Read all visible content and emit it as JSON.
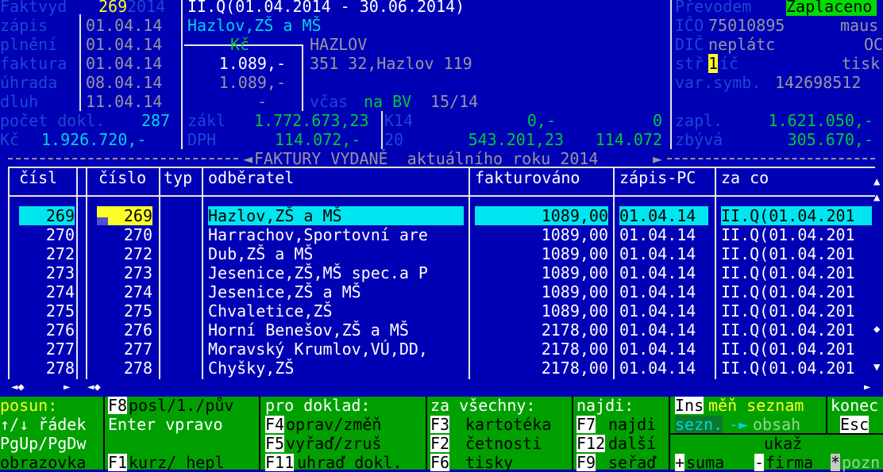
{
  "header_left": {
    "labels": [
      "Faktvyd",
      "zápis",
      "plnění",
      "faktura",
      "úhrada",
      "dluh"
    ],
    "invoice_no": "269",
    "year": "2014",
    "dates": [
      "01.04.14",
      "01.04.14",
      "01.04.14",
      "08.04.14",
      "11.04.14"
    ]
  },
  "header_mid": {
    "period": "II.Q(01.04.2014 - 30.06.2014)",
    "customer": "Hazlov,ZŠ a MŠ",
    "kc_label": "Kč",
    "city": "HAZLOV",
    "address": "351 32,Hazlov 119",
    "amounts": [
      "1.089,-",
      "1.089,-",
      "-"
    ],
    "vcas": "včas",
    "na_bv": "na BV",
    "bv_count": "15/14"
  },
  "header_right": {
    "prevodem": "Převodem",
    "status": "Zaplaceno",
    "ico_label": "IČO",
    "ico": "75010895",
    "maus": "maus",
    "dic_label": "DIČ",
    "dic": "neplátc",
    "oc": "OC",
    "stredisko_s": "stř",
    "stredisko_val": "1",
    "stredisko_rest": "íč",
    "tisk": "tisk",
    "var_symb_label": "var.symb.",
    "var_symb": "142698512"
  },
  "summary": {
    "pocet_label": "počet dokl.",
    "pocet": "287",
    "kc_label": "Kč",
    "kc_total": "1.926.720,-",
    "zakl_label": "zákl",
    "zakl": "1.772.673,23",
    "dph_label": "DPH",
    "dph": "114.072,-",
    "k14": "K14",
    "k14_val": "0,-",
    "k14_val2": "0",
    "r20": "20",
    "r20_val": "543.201,23",
    "r20_val2": "114.072",
    "zapl_label": "zapl.",
    "zapl": "1.621.050,-",
    "zbyva_label": "zbývá",
    "zbyva": "305.670,-"
  },
  "title_bar": "FAKTURY VYDANÉ__aktuálního roku 2014",
  "columns": {
    "cisl": "čísl",
    "cislo": "číslo",
    "typ": "typ",
    "odberatel": "odběratel",
    "fakturovano": "fakturováno",
    "zapis_pc": "zápis-PC",
    "za_co": "za co"
  },
  "rows": [
    {
      "cisl": "269",
      "cislo": "269",
      "typ": "",
      "odberatel": "Hazlov,ZŠ a MŠ",
      "fakt": "1089,00",
      "zapis": "01.04.14",
      "zaco": "II.Q(01.04.201"
    },
    {
      "cisl": "270",
      "cislo": "270",
      "typ": "",
      "odberatel": "Harrachov,Sportovní are",
      "fakt": "1089,00",
      "zapis": "01.04.14",
      "zaco": "II.Q(01.04.201"
    },
    {
      "cisl": "272",
      "cislo": "272",
      "typ": "",
      "odberatel": "Dub,ZŠ a MŠ",
      "fakt": "1089,00",
      "zapis": "01.04.14",
      "zaco": "II.Q(01.04.201"
    },
    {
      "cisl": "273",
      "cislo": "273",
      "typ": "",
      "odberatel": "Jesenice,ZŠ,MŠ spec.a P",
      "fakt": "1089,00",
      "zapis": "01.04.14",
      "zaco": "II.Q(01.04.201"
    },
    {
      "cisl": "274",
      "cislo": "274",
      "typ": "",
      "odberatel": "Jesenice,ZŠ a MŠ",
      "fakt": "1089,00",
      "zapis": "01.04.14",
      "zaco": "II.Q(01.04.201"
    },
    {
      "cisl": "275",
      "cislo": "275",
      "typ": "",
      "odberatel": "Chvaletice,ZŠ",
      "fakt": "1089,00",
      "zapis": "01.04.14",
      "zaco": "II.Q(01.04.201"
    },
    {
      "cisl": "276",
      "cislo": "276",
      "typ": "",
      "odberatel": "Horní Benešov,ZŠ a MŠ",
      "fakt": "2178,00",
      "zapis": "01.04.14",
      "zaco": "II.Q(01.04.201"
    },
    {
      "cisl": "277",
      "cislo": "277",
      "typ": "",
      "odberatel": "Moravský Krumlov,VÚ,DD,",
      "fakt": "2178,00",
      "zapis": "01.04.14",
      "zaco": "II.Q(01.04.201"
    },
    {
      "cisl": "278",
      "cislo": "278",
      "typ": "",
      "odberatel": "Chyšky,ZŠ",
      "fakt": "2178,00",
      "zapis": "01.04.14",
      "zaco": "II.Q(01.04.201"
    }
  ],
  "footer": {
    "posun": "posun:",
    "radek": "↑/↓ řádek",
    "pgupdw": "PgUp/PgDw",
    "obrazovka": "obrazovka",
    "f8": "F8",
    "f8_text": "posl/1./pův",
    "enter_vpravo": "Enter vpravo",
    "f1": "F1",
    "f1_text": "kurz/ hepl",
    "pro_doklad": "pro doklad:",
    "f4": "F4",
    "f4_text": "oprav/změň",
    "f5": "F5",
    "f5_text": "vyřaď/zruš",
    "f11": "F11",
    "f11_text": "uhraď dokl.",
    "za_vsechny": "za všechny:",
    "f3": "F3",
    "f3_text": "kartotéka",
    "f2": "F2",
    "f2_text": "četnosti",
    "f6": "F6",
    "f6_text": "tisky",
    "najdi": "najdi:",
    "f7": "F7",
    "f7_text": "najdi",
    "f12": "F12",
    "f12_text": "další",
    "f9": "F9",
    "f9_text": "seřaď",
    "ins": "Ins",
    "men_seznam": "měň seznam",
    "sezn": "sezn.",
    "arrow": "-►",
    "obsah": "obsah",
    "ukaz": "ukaž",
    "plus": "+",
    "suma": "suma",
    "minus": "-",
    "firma": "firma",
    "star": "*",
    "pozn": "pozn",
    "konec": "konec",
    "esc": "Esc"
  },
  "colors": {
    "background": "#0000b4",
    "row_highlight": "#00e6f0",
    "footer_green": "#00a000",
    "status_green": "#00dc00",
    "yellow": "#ffff28"
  }
}
